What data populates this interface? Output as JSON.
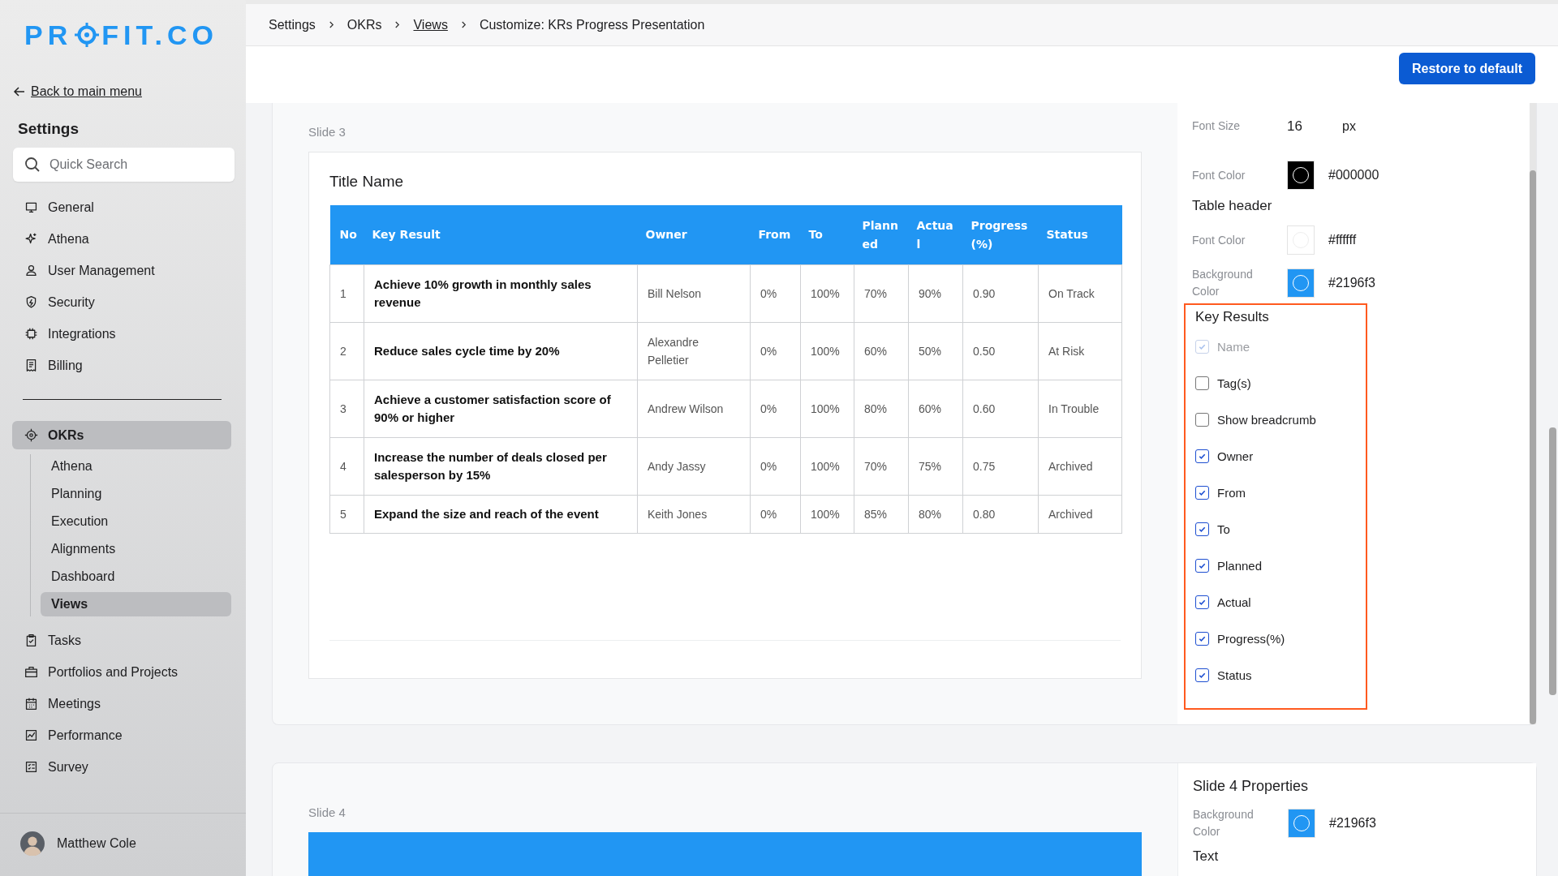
{
  "sidebar": {
    "logo": {
      "before": "PR",
      "after": "FIT.CO"
    },
    "back_link": "Back to main menu",
    "title": "Settings",
    "search": {
      "placeholder": "Quick Search"
    },
    "items": [
      {
        "label": "General",
        "selected": false
      },
      {
        "label": "Athena",
        "selected": false
      },
      {
        "label": "User Management",
        "selected": false
      },
      {
        "label": "Security",
        "selected": false
      },
      {
        "label": "Integrations",
        "selected": false
      },
      {
        "label": "Billing",
        "selected": false
      }
    ],
    "sections": [
      {
        "label": "OKRs",
        "selected": true,
        "children": [
          {
            "label": "Athena",
            "selected": false
          },
          {
            "label": "Planning",
            "selected": false
          },
          {
            "label": "Execution",
            "selected": false
          },
          {
            "label": "Alignments",
            "selected": false
          },
          {
            "label": "Dashboard",
            "selected": false
          },
          {
            "label": "Views",
            "selected": true
          }
        ]
      },
      {
        "label": "Tasks",
        "selected": false
      },
      {
        "label": "Portfolios and Projects",
        "selected": false
      },
      {
        "label": "Meetings",
        "selected": false
      },
      {
        "label": "Performance",
        "selected": false
      },
      {
        "label": "Survey",
        "selected": false
      }
    ],
    "user": "Matthew Cole"
  },
  "breadcrumb": [
    {
      "label": "Settings",
      "link": false
    },
    {
      "label": "OKRs",
      "link": false
    },
    {
      "label": "Views",
      "link": true
    },
    {
      "label": "Customize: KRs Progress Presentation",
      "link": false
    }
  ],
  "restore_button": "Restore to default",
  "slide3": {
    "label": "Slide 3",
    "title": "Title Name",
    "table": {
      "columns": [
        "No",
        "Key Result",
        "Owner",
        "From",
        "To",
        "Planned",
        "Actual",
        "Progress(%)",
        "Status"
      ],
      "rows": [
        [
          "1",
          "Achieve 10% growth in monthly sales revenue",
          "Bill Nelson",
          "0%",
          "100%",
          "70%",
          "90%",
          "0.90",
          "On Track"
        ],
        [
          "2",
          "Reduce sales cycle time by 20%",
          "Alexandre Pelletier",
          "0%",
          "100%",
          "60%",
          "50%",
          "0.50",
          "At Risk"
        ],
        [
          "3",
          "Achieve a customer satisfaction score of 90% or higher",
          "Andrew Wilson",
          "0%",
          "100%",
          "80%",
          "60%",
          "0.60",
          "In Trouble"
        ],
        [
          "4",
          "Increase the number of deals closed per salesperson by 15%",
          "Andy Jassy",
          "0%",
          "100%",
          "70%",
          "75%",
          "0.75",
          "Archived"
        ],
        [
          "5",
          "Expand the size and reach of the event",
          "Keith Jones",
          "0%",
          "100%",
          "85%",
          "80%",
          "0.80",
          "Archived"
        ]
      ]
    }
  },
  "properties": {
    "font_size": {
      "label": "Font Size",
      "value": "16",
      "unit": "px"
    },
    "font_color": {
      "label": "Font Color",
      "value": "#000000",
      "color": "#000000"
    },
    "table_header": {
      "title": "Table header",
      "font_color": {
        "label": "Font Color",
        "value": "#ffffff",
        "color": "#ffffff"
      },
      "background_color": {
        "label": "Background Color",
        "value": "#2196f3",
        "color": "#2196f3"
      }
    },
    "key_results": {
      "title": "Key Results",
      "options": [
        {
          "label": "Name",
          "checked": true,
          "disabled": true
        },
        {
          "label": "Tag(s)",
          "checked": false,
          "disabled": false
        },
        {
          "label": "Show breadcrumb",
          "checked": false,
          "disabled": false
        },
        {
          "label": "Owner",
          "checked": true,
          "disabled": false
        },
        {
          "label": "From",
          "checked": true,
          "disabled": false
        },
        {
          "label": "To",
          "checked": true,
          "disabled": false
        },
        {
          "label": "Planned",
          "checked": true,
          "disabled": false
        },
        {
          "label": "Actual",
          "checked": true,
          "disabled": false
        },
        {
          "label": "Progress(%)",
          "checked": true,
          "disabled": false
        },
        {
          "label": "Status",
          "checked": true,
          "disabled": false
        }
      ]
    }
  },
  "slide4": {
    "label": "Slide 4",
    "properties_title": "Slide 4 Properties",
    "background_color": {
      "label": "Background Color",
      "value": "#2196f3",
      "color": "#2196f3"
    },
    "text_heading": "Text"
  }
}
